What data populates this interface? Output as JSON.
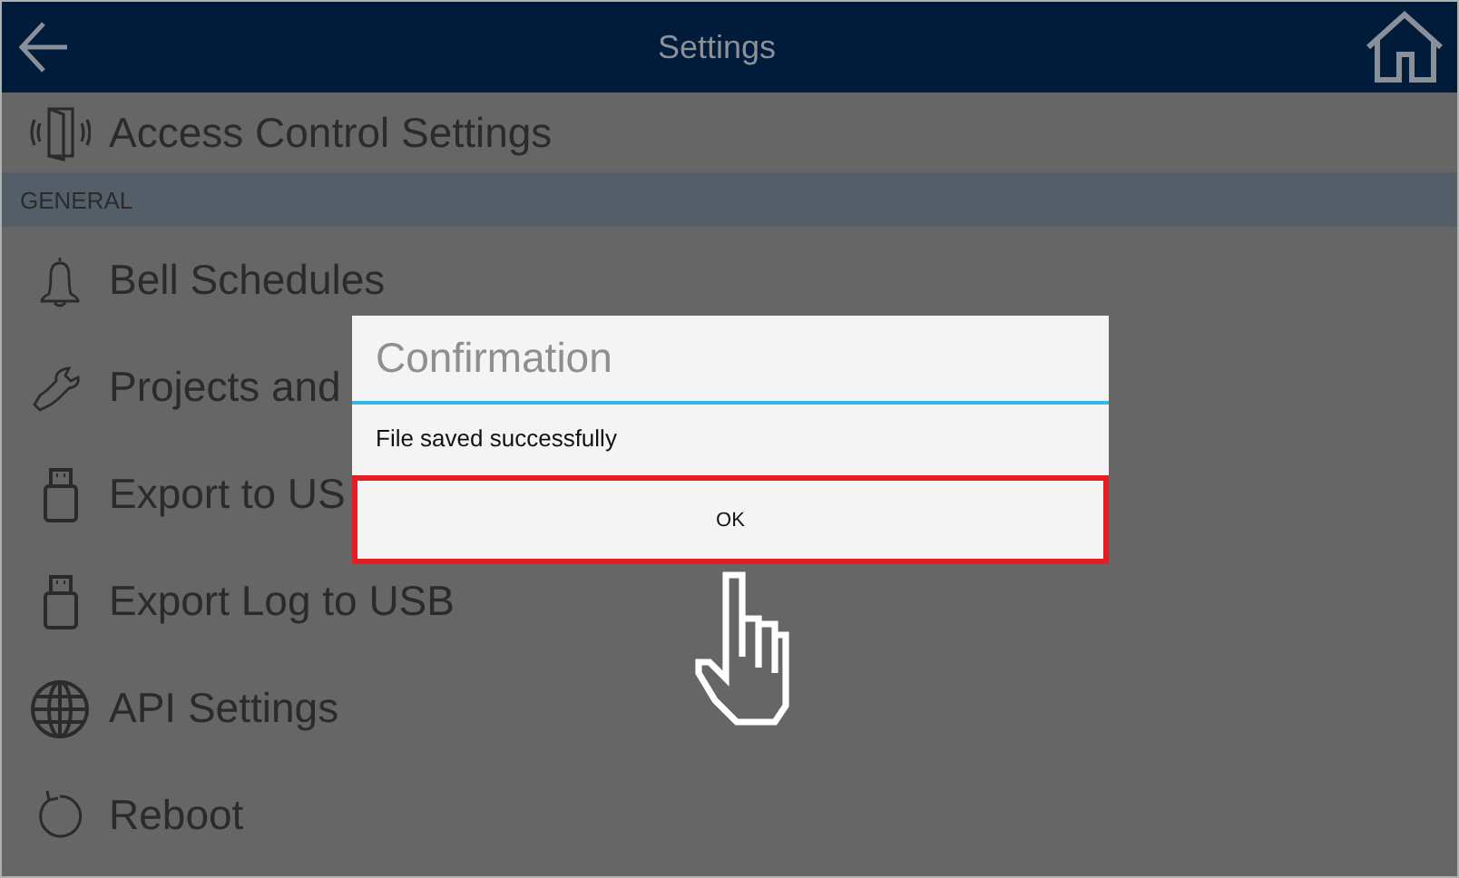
{
  "header": {
    "title": "Settings"
  },
  "list": [
    {
      "kind": "item",
      "label": "Access Control Settings"
    },
    {
      "kind": "section",
      "label": "GENERAL"
    },
    {
      "kind": "item",
      "label": "Bell Schedules"
    },
    {
      "kind": "item",
      "label": "Projects and"
    },
    {
      "kind": "item",
      "label": "Export to US"
    },
    {
      "kind": "item",
      "label": "Export Log to USB"
    },
    {
      "kind": "item",
      "label": "API Settings"
    },
    {
      "kind": "item",
      "label": "Reboot"
    }
  ],
  "dialog": {
    "title": "Confirmation",
    "message": "File saved successfully",
    "button": "OK",
    "highlighted": true
  }
}
